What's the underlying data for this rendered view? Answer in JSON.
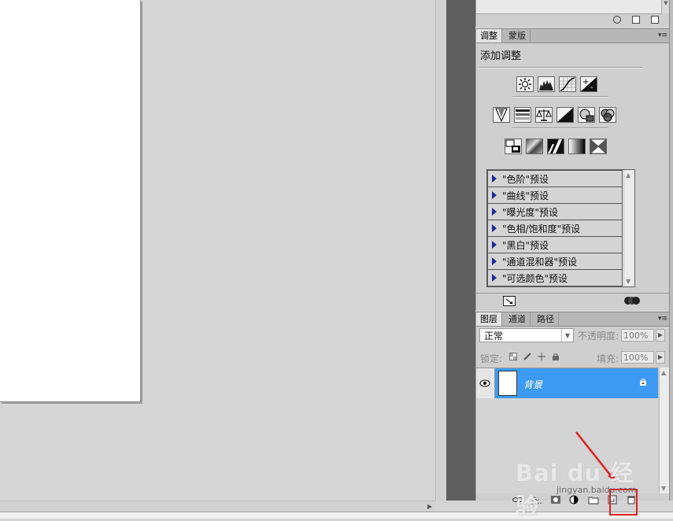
{
  "adjustments_panel": {
    "tabs": [
      "调整",
      "蒙版"
    ],
    "title": "添加调整",
    "presets": [
      "\"色阶\"预设",
      "\"曲线\"预设",
      "\"曝光度\"预设",
      "\"色相/饱和度\"预设",
      "\"黑白\"预设",
      "\"通道混和器\"预设",
      "\"可选颜色\"预设"
    ]
  },
  "layers_panel": {
    "tabs": [
      "图层",
      "通道",
      "路径"
    ],
    "blend_mode": "正常",
    "opacity_label": "不透明度:",
    "opacity_value": "100%",
    "lock_label": "锁定:",
    "fill_label": "填充:",
    "fill_value": "100%",
    "layer_name": "背景"
  },
  "watermark": {
    "brand": "Bai du 经验",
    "url": "jingyan.baidu.com"
  },
  "colors": {
    "selection": "#3d9af3",
    "highlight": "#e02020",
    "preset_arrow": "#1a2a9a"
  }
}
